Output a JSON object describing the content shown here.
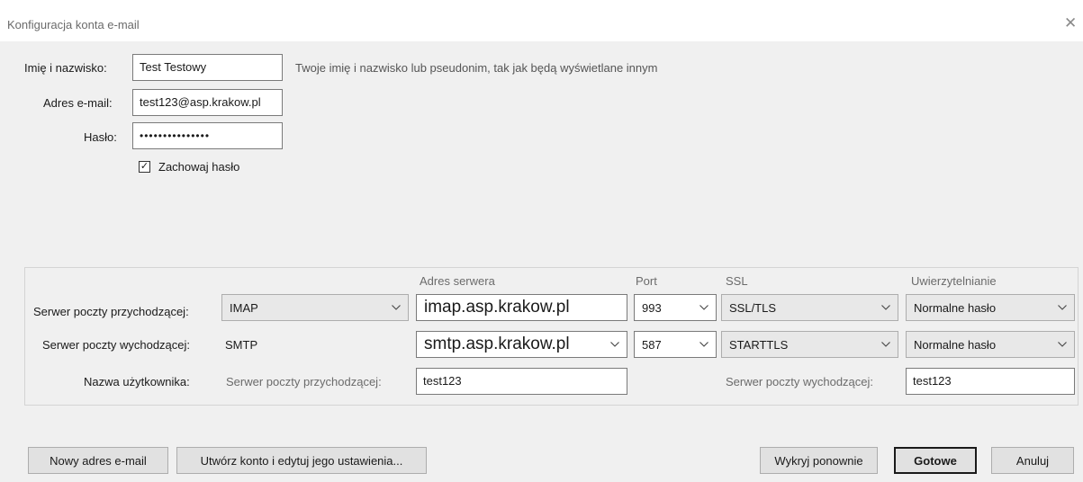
{
  "window": {
    "title": "Konfiguracja konta e-mail",
    "close_glyph": "✕"
  },
  "identity": {
    "name_label": "Imię i nazwisko:",
    "name_value": "Test Testowy",
    "name_hint": "Twoje imię i nazwisko lub pseudonim, tak jak będą wyświetlane innym",
    "email_label": "Adres e-mail:",
    "email_value": "test123@asp.krakow.pl",
    "password_label": "Hasło:",
    "password_value": "•••••••••••••••",
    "remember_label": "Zachowaj hasło",
    "remember_checked": true
  },
  "server": {
    "headers": {
      "address": "Adres serwera",
      "port": "Port",
      "ssl": "SSL",
      "auth": "Uwierzytelnianie"
    },
    "incoming": {
      "label": "Serwer poczty przychodzącej:",
      "protocol": "IMAP",
      "address": "imap.asp.krakow.pl",
      "port": "993",
      "ssl": "SSL/TLS",
      "auth": "Normalne hasło"
    },
    "outgoing": {
      "label": "Serwer poczty wychodzącej:",
      "protocol": "SMTP",
      "address": "smtp.asp.krakow.pl",
      "port": "587",
      "ssl": "STARTTLS",
      "auth": "Normalne hasło"
    },
    "username": {
      "label": "Nazwa użytkownika:",
      "incoming_label": "Serwer poczty przychodzącej:",
      "incoming_value": "test123",
      "outgoing_label": "Serwer poczty wychodzącej:",
      "outgoing_value": "test123"
    }
  },
  "buttons": {
    "new_address": "Nowy adres e-mail",
    "create_edit": "Utwórz konto i edytuj jego ustawienia...",
    "retest": "Wykryj ponownie",
    "done": "Gotowe",
    "cancel": "Anuluj"
  }
}
